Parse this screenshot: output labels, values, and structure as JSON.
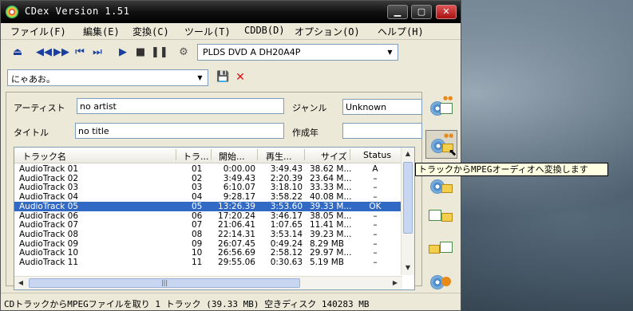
{
  "window": {
    "title": "CDex Version 1.51"
  },
  "menu": [
    "ファイル(F)",
    "編集(E)",
    "変換(C)",
    "ツール(T)",
    "CDDB(D)",
    "オプション(O)",
    "ヘルプ(H)"
  ],
  "toolbar": {
    "drive": "PLDS    DVD A  DH20A4P",
    "icons": [
      "eject-icon",
      "rewind-icon",
      "fast-forward-icon",
      "skip-back-icon",
      "skip-forward-icon",
      "play-icon",
      "stop-icon",
      "pause-icon",
      "config-icon"
    ]
  },
  "preset": {
    "value": "にゃあお。"
  },
  "info": {
    "artist_label": "アーティスト",
    "artist_value": "no artist",
    "genre_label": "ジャンル",
    "genre_value": "Unknown",
    "title_label": "タイトル",
    "title_value": "no title",
    "year_label": "作成年",
    "year_value": ""
  },
  "tracks": {
    "columns": [
      "トラック名",
      "トラ...",
      "開始...",
      "再生...",
      "サイズ",
      "Status"
    ],
    "rows": [
      {
        "name": "AudioTrack 01",
        "num": "01",
        "start": "0:00.00",
        "play": "3:49.43",
        "size": "38.62 M...",
        "status": "A",
        "selected": false
      },
      {
        "name": "AudioTrack 02",
        "num": "02",
        "start": "3:49.43",
        "play": "2:20.39",
        "size": "23.64 M...",
        "status": "–",
        "selected": false
      },
      {
        "name": "AudioTrack 03",
        "num": "03",
        "start": "6:10.07",
        "play": "3:18.10",
        "size": "33.33 M...",
        "status": "–",
        "selected": false
      },
      {
        "name": "AudioTrack 04",
        "num": "04",
        "start": "9:28.17",
        "play": "3:58.22",
        "size": "40.08 M...",
        "status": "–",
        "selected": false
      },
      {
        "name": "AudioTrack 05",
        "num": "05",
        "start": "13:26.39",
        "play": "3:53.60",
        "size": "39.33 M...",
        "status": "OK",
        "selected": true
      },
      {
        "name": "AudioTrack 06",
        "num": "06",
        "start": "17:20.24",
        "play": "3:46.17",
        "size": "38.05 M...",
        "status": "–",
        "selected": false
      },
      {
        "name": "AudioTrack 07",
        "num": "07",
        "start": "21:06.41",
        "play": "1:07.65",
        "size": "11.41 M...",
        "status": "–",
        "selected": false
      },
      {
        "name": "AudioTrack 08",
        "num": "08",
        "start": "22:14.31",
        "play": "3:53.14",
        "size": "39.23 M...",
        "status": "–",
        "selected": false
      },
      {
        "name": "AudioTrack 09",
        "num": "09",
        "start": "26:07.45",
        "play": "0:49.24",
        "size": "8.29 MB",
        "status": "–",
        "selected": false
      },
      {
        "name": "AudioTrack 10",
        "num": "10",
        "start": "26:56.69",
        "play": "2:58.12",
        "size": "29.97 M...",
        "status": "–",
        "selected": false
      },
      {
        "name": "AudioTrack 11",
        "num": "11",
        "start": "29:55.06",
        "play": "0:30.63",
        "size": "5.19 MB",
        "status": "–",
        "selected": false
      }
    ]
  },
  "tooltip": "トラックからMPEGオーディオへ変換します",
  "status": "CDトラックからMPEGファイルを取り 1 トラック (39.33 MB) 空きディスク 140283 MB"
}
